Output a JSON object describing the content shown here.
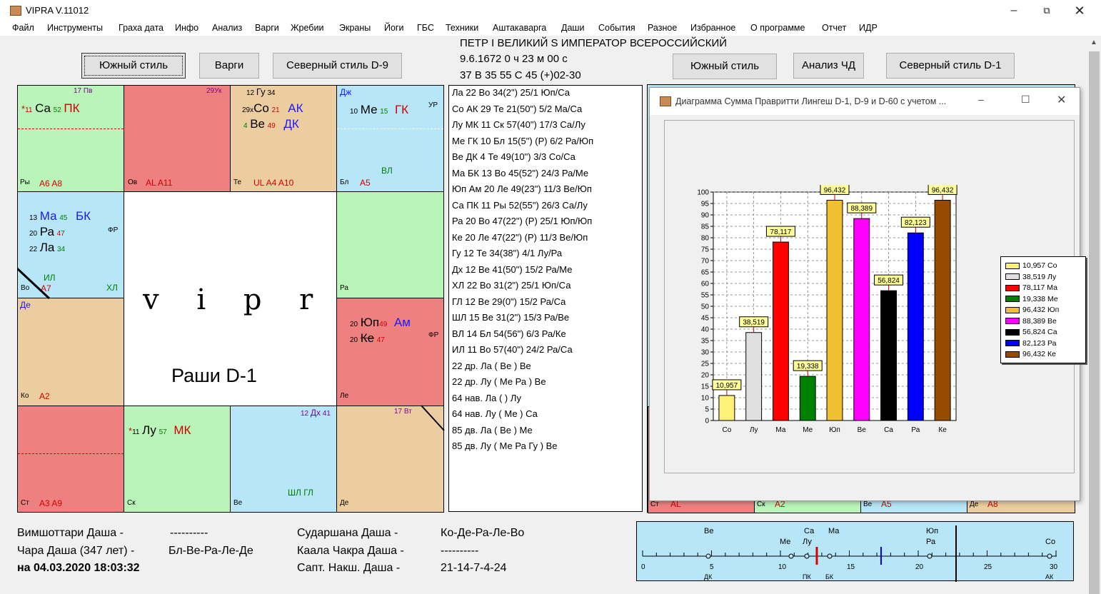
{
  "app": {
    "title": "VIPRA V.11012"
  },
  "menu": [
    "Файл",
    "Инструменты",
    "Граха дата",
    "Инфо",
    "Анализ",
    "Варги",
    "Жребии",
    "Экраны",
    "Йоги",
    "ГБС",
    "Техники",
    "Аштакаварга",
    "Даши",
    "События",
    "Разное",
    "Избранное",
    "О программе",
    "Отчет",
    "ИДР"
  ],
  "buttons": {
    "south1": "Южный стиль",
    "vargi": "Варги",
    "north9": "Северный стиль D-9",
    "south2": "Южный стиль",
    "chd": "Анализ ЧД",
    "north1": "Северный стиль D-1"
  },
  "header": {
    "name": "ПЕТР I  ВЕЛИКИЙ S ИМПЕРАТОР ВСЕРОССИЙСКИЙ",
    "date": "9.6.1672   0 ч 23 м 00 с",
    "coords": "37 В 35   55 С 45   (+)02-30"
  },
  "rashi": {
    "logo": "v  i  p  r  a",
    "caption": "Раши D-1",
    "pi": {
      "deg": "17",
      "name": "Пв",
      "nak": "11",
      "planet": "Са",
      "deg2": "52",
      "karaka": "ПК",
      "sign": "Ры",
      "a": "A6  A8"
    },
    "ar": {
      "deg": "29",
      "name": "Ук",
      "sign": "Ов",
      "a": "AL  A11"
    },
    "ta": {
      "gu": "12",
      "guname": "Гу",
      "gudeg": "34",
      "so": "29",
      "sonm": "Со",
      "sodeg": "21",
      "sokar": "АК",
      "ve": "4",
      "venm": "Ве",
      "vedeg": "49",
      "vekar": "ДК",
      "sign": "Те",
      "a": "UL  A4  A10"
    },
    "ge": {
      "dj": "Дж",
      "me": "10",
      "menm": "Ме",
      "medeg": "15",
      "mekar": "ГК",
      "up": "УР",
      "vl": "ВЛ",
      "sign": "Бл",
      "a": "A5"
    },
    "aq": {
      "ma": "13",
      "manm": "Ма",
      "madeg": "45",
      "makar": "БК",
      "ra": "20",
      "ranm": "Ра",
      "radeg": "47",
      "fr": "ФР",
      "la": "22",
      "lanm": "Ла",
      "ladeg": "34",
      "il": "ИЛ",
      "xl": "ХЛ",
      "sign": "Во",
      "a": "A7"
    },
    "ca": {
      "sign": "Ра"
    },
    "cap": {
      "de": "Де",
      "sign": "Ко",
      "a": "A2"
    },
    "le": {
      "ju": "20",
      "junm": "Юп",
      "judeg": "49",
      "jukar": "Ам",
      "ke": "20",
      "kenm": "Ке",
      "kedeg": "47",
      "fr": "ФР",
      "sign": "Ле"
    },
    "sag": {
      "sign": "Ст",
      "a": "A3  A9"
    },
    "sco": {
      "nak": "11",
      "nm": "Лу",
      "deg": "57",
      "kar": "МК",
      "sign": "Ск"
    },
    "lib": {
      "dx": "12",
      "dxnm": "Дх",
      "dxdeg": "41",
      "sl": "ШЛ ГЛ",
      "sign": "Ве"
    },
    "vir": {
      "vt": "17",
      "vtnm": "Вт",
      "sign": "Де"
    }
  },
  "planets": [
    "Ла      22 Во 34(2\")      25/1 Юп/Са",
    "Со  АК 29 Те 21(50\")     5/2 Ма/Са",
    "Лу  МК 11 Ск 57(40\")     17/3 Са/Лу",
    "Ме  ГК 10 Бл 15(5\")   (Р) 6/2 Ра/Юп",
    "Ве  ДК 4   Те 49(10\")     3/3 Со/Са",
    "Ма  БК 13 Во 45(52\")     24/3 Ра/Ме",
    "Юп Ам 20 Ле 49(23\")     11/3 Ве/Юп",
    "Са  ПК 11 Ры 52(55\")     26/3 Са/Лу",
    "Ра       20 Во 47(22\") (Р) 25/1 Юп/Юп",
    "Ке       20 Ле 47(22\") (Р) 11/3 Ве/Юп",
    "Гу       12 Те 34(38\")     4/1 Лу/Ра",
    "Дх       12 Ве 41(50\")     15/2 Ра/Ме",
    "ХЛ       22 Во 31(2\")      25/1 Юп/Са",
    "ГЛ       12 Ве 29(0\")      15/2 Ра/Са",
    "ШЛ     15 Ве 31(2\")      15/3 Ра/Ве",
    "ВЛ       14 Бл 54(56\")     6/3 Ра/Ке",
    "ИЛ       11 Во 57(40\")     24/2 Ра/Са",
    "22 др. Ла ( Ве ) Ве",
    "22 др. Лу ( Ме Ра ) Ве",
    "64 нав. Ла ( ) Лу",
    "64 нав. Лу ( Ме ) Са",
    "85 дв. Ла ( Ве ) Ме",
    "85 дв. Лу ( Ме Ра Гу ) Ве"
  ],
  "chartwin": {
    "title": "Диаграмма Сумма Правритти Лингеш D-1, D-9 и D-60 с учетом ..."
  },
  "chart_data": {
    "type": "bar",
    "categories": [
      "Со",
      "Лу",
      "Ма",
      "Ме",
      "Юп",
      "Ве",
      "Са",
      "Ра",
      "Ке"
    ],
    "values": [
      10.957,
      38.519,
      78.117,
      19.338,
      96.432,
      88.389,
      56.824,
      82.123,
      96.432
    ],
    "labels": [
      "10,957",
      "38,519",
      "78,117",
      "19,338",
      "96,432",
      "88,389",
      "56,824",
      "82,123",
      "96,432"
    ],
    "colors": [
      "#fff176",
      "#e0e0e0",
      "#ff0000",
      "#008000",
      "#f0c030",
      "#ff00ff",
      "#000000",
      "#0000ff",
      "#964B00"
    ],
    "ylim": [
      0,
      100
    ],
    "yticks": [
      0,
      5,
      10,
      15,
      20,
      25,
      30,
      35,
      40,
      45,
      50,
      55,
      60,
      65,
      70,
      75,
      80,
      85,
      90,
      95,
      100
    ],
    "grid": true,
    "legend_position": "right",
    "legend": [
      "10,957 Со",
      "38,519 Лу",
      "78,117 Ма",
      "19,338 Ме",
      "96,432 Юп",
      "88,389 Ве",
      "56,824 Са",
      "82,123 Ра",
      "96,432 Ке"
    ],
    "title": "",
    "xlabel": "",
    "ylabel": ""
  },
  "behind": {
    "st": "Ст",
    "al": "AL",
    "sk": "Ск",
    "a2": "A2",
    "ve": "Ве",
    "a5": "A5",
    "de": "Де",
    "a8": "A8"
  },
  "bottom": {
    "vim_label": "Вимшоттари Даша -",
    "vim_val": "----------",
    "chara_label": "Чара Даша (347 лет) -",
    "chara_val": "Бл-Ве-Ра-Ле-Де",
    "date": "на 04.03.2020 18:03:32",
    "sud_label": "Сударшана Даша -",
    "sud_val": "Ко-Де-Ра-Ле-Во",
    "kaal_label": "Каала Чакра Даша -",
    "kaal_val": "----------",
    "sapt_label": "Сапт. Накш. Даша -",
    "sapt_val": "21-14-7-4-24"
  },
  "timeline": {
    "top": [
      "Ве",
      "Са",
      "Ма",
      "Юп",
      "Ме",
      "Лу",
      "Ра",
      "Со"
    ],
    "ticks": [
      "0",
      "5",
      "10",
      "15",
      "20",
      "25",
      "30"
    ],
    "below": [
      "ДК",
      "ПК",
      "БК",
      "АК"
    ]
  }
}
